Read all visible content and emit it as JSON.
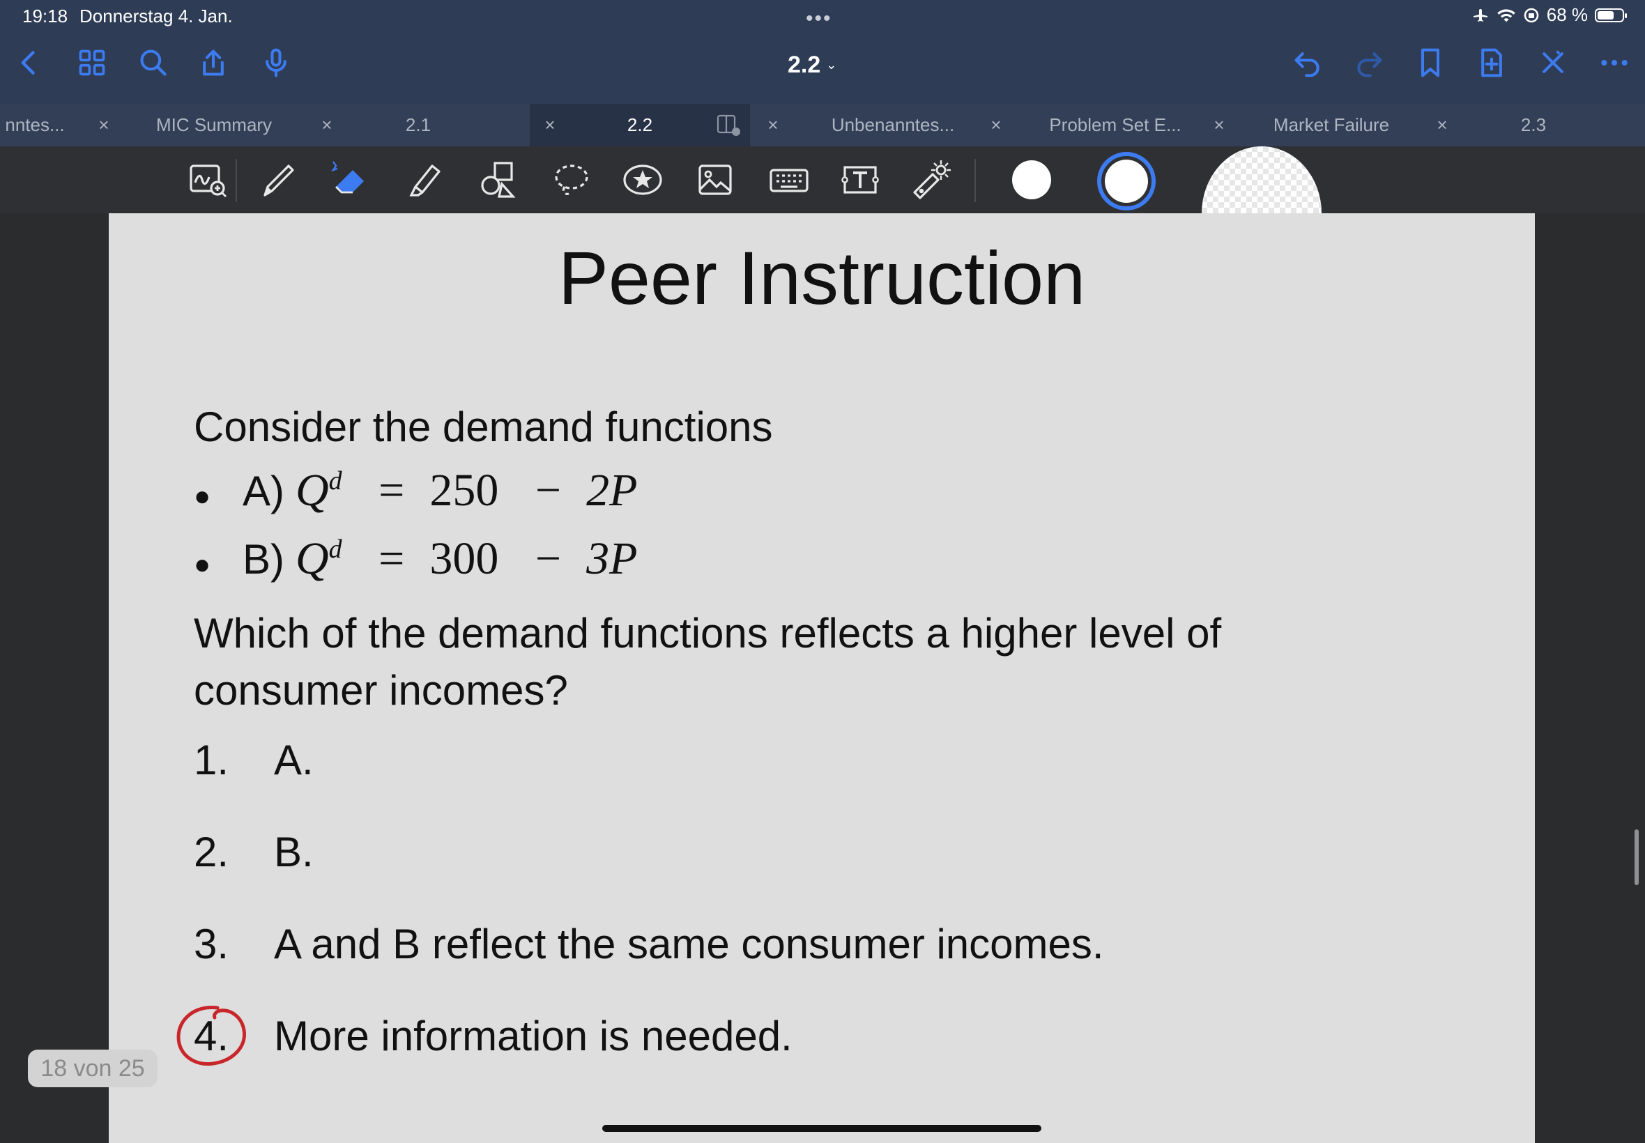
{
  "status": {
    "time": "19:18",
    "date": "Donnerstag 4. Jan.",
    "battery": "68 %",
    "battery_level": 0.68,
    "dots": "•••"
  },
  "nav": {
    "doc_title": "2.2",
    "chevron": "⌄",
    "icons": [
      "back-chevron-icon",
      "grid-icon",
      "search-icon",
      "share-icon",
      "microphone-icon",
      "undo-icon",
      "redo-icon",
      "bookmark-icon",
      "add-page-icon",
      "close-tools-icon",
      "more-icon"
    ]
  },
  "tabs": [
    {
      "label": "nntes..."
    },
    {
      "label": "MIC Summary"
    },
    {
      "label": "2.1"
    },
    {
      "label": "2.2",
      "active": true
    },
    {
      "label": "Unbenanntes..."
    },
    {
      "label": "Problem Set E..."
    },
    {
      "label": "Market Failure"
    },
    {
      "label": "2.3"
    }
  ],
  "tab_close": "×",
  "toolbar": {
    "tools": [
      "zoom-write-icon",
      "pen-icon",
      "eraser-icon",
      "highlighter-icon",
      "shapes-icon",
      "lasso-icon",
      "sticker-icon",
      "image-icon",
      "keyboard-icon",
      "text-box-icon",
      "laser-pointer-icon"
    ],
    "colors": [
      "#ffffff",
      "#ffffff",
      "#ffffff"
    ],
    "accent": "#3d7bf0"
  },
  "slide": {
    "title": "Peer Instruction",
    "intro": "Consider the demand functions",
    "bullets": [
      {
        "label": "A)",
        "q": "Q",
        "sup": "d",
        "eq": "=",
        "a": "250",
        "minus": "−",
        "b": "2P"
      },
      {
        "label": "B)",
        "q": "Q",
        "sup": "d",
        "eq": "=",
        "a": "300",
        "minus": "−",
        "b": "3P"
      }
    ],
    "question_line1": "Which of the demand functions reflects a higher level of",
    "question_line2": "consumer incomes?",
    "options": [
      {
        "num": "1.",
        "text": "A."
      },
      {
        "num": "2.",
        "text": "B."
      },
      {
        "num": "3.",
        "text": "A and B reflect the same consumer incomes."
      },
      {
        "num": "4.",
        "text": "More information is needed."
      }
    ],
    "annotation_color": "#c8262a"
  },
  "page_indicator": "18 von 25"
}
